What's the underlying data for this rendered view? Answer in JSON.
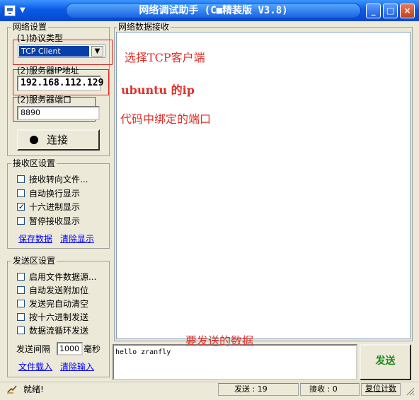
{
  "window": {
    "title": "网络调试助手 (C■精装版 V3.8)",
    "minimize_glyph": "_",
    "maximize_glyph": "□",
    "close_glyph": "×",
    "sysmenu_arrow": "▼"
  },
  "network": {
    "title": "网络设置",
    "protocol_label": "(1)协议类型",
    "protocol_value": "TCP Client",
    "server_ip_label": "(2)服务器IP地址",
    "server_ip_value": "192.168.112.129",
    "server_port_label": "(2)服务器端口",
    "server_port_value": "8890",
    "connect_label": "连接"
  },
  "receive_settings": {
    "title": "接收区设置",
    "options": [
      {
        "label": "接收转向文件...",
        "checked": false
      },
      {
        "label": "自动换行显示",
        "checked": false
      },
      {
        "label": "十六进制显示",
        "checked": true
      },
      {
        "label": "暂停接收显示",
        "checked": false
      }
    ],
    "save_link": "保存数据",
    "clear_link": "清除显示"
  },
  "send_settings": {
    "title": "发送区设置",
    "options": [
      {
        "label": "启用文件数据源...",
        "checked": false
      },
      {
        "label": "自动发送附加位",
        "checked": false
      },
      {
        "label": "发送完自动清空",
        "checked": false
      },
      {
        "label": "按十六进制发送",
        "checked": false
      },
      {
        "label": "数据流循环发送",
        "checked": false
      }
    ],
    "interval_label": "发送间隔",
    "interval_value": "1000",
    "interval_unit": "毫秒",
    "load_file_link": "文件载入",
    "clear_input_link": "清除输入"
  },
  "receive_area": {
    "title": "网络数据接收"
  },
  "annotations": {
    "protocol_note": "选择TCP客户端",
    "ip_note": "ubuntu 的ip",
    "port_note": "代码中绑定的端口",
    "send_note": "要发送的数据"
  },
  "send_area": {
    "text": "hello zranfly",
    "send_button": "发送"
  },
  "status": {
    "ready": "就绪!",
    "sent_label": "发送 : 19",
    "recv_label": "接收 : 0",
    "reset_label": "复位计数"
  },
  "colors": {
    "annotation": "#e0302a",
    "send_button_text": "#1f8a1f",
    "link": "#0000ff"
  }
}
